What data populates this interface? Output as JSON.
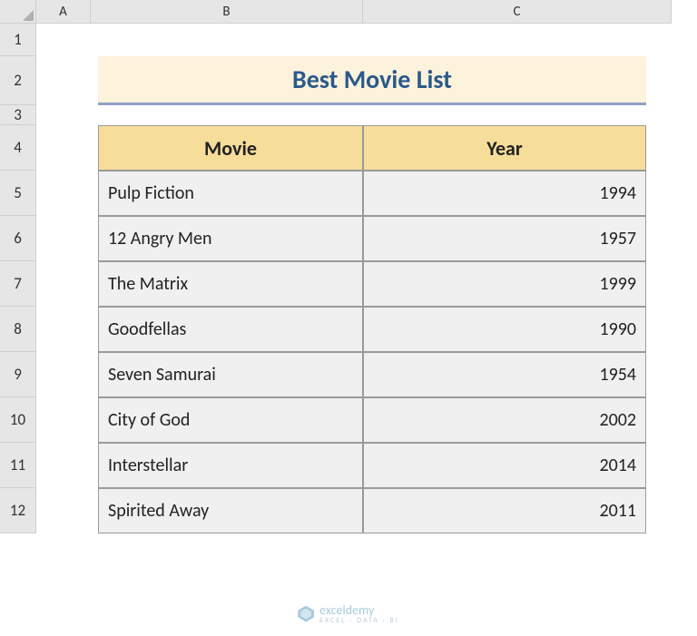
{
  "columns": [
    "A",
    "B",
    "C"
  ],
  "rows": [
    "1",
    "2",
    "3",
    "4",
    "5",
    "6",
    "7",
    "8",
    "9",
    "10",
    "11",
    "12"
  ],
  "title": "Best Movie List",
  "headers": {
    "movie": "Movie",
    "year": "Year"
  },
  "movies": [
    {
      "name": " Pulp  Fiction",
      "year": "1994"
    },
    {
      "name": " 12 Angry Men",
      "year": "1957"
    },
    {
      "name": "The Matrix",
      "year": "1999"
    },
    {
      "name": " Goodfellas",
      "year": "1990"
    },
    {
      "name": "Seven Samurai",
      "year": "1954"
    },
    {
      "name": " City of God",
      "year": "2002"
    },
    {
      "name": "Interstellar",
      "year": "2014"
    },
    {
      "name": " Spirited Away",
      "year": "2011"
    }
  ],
  "watermark": {
    "brand": "exceldemy",
    "subtitle": "EXCEL · DATA · BI"
  }
}
